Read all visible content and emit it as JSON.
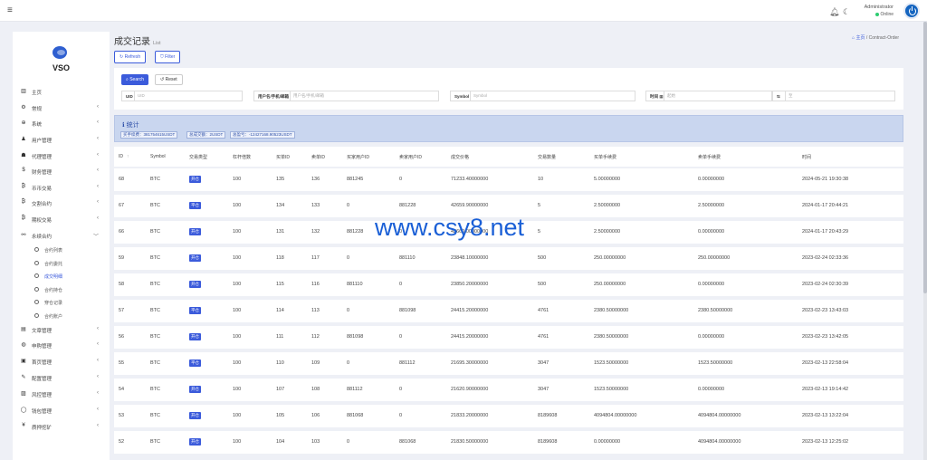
{
  "topbar": {
    "menu_icon": "hamburger-icon",
    "admin_name": "Administrator",
    "status": "Online"
  },
  "sidebar": {
    "logo_text": "VSO",
    "items": [
      {
        "label": "主页",
        "icon": "dashboard-icon",
        "chevron": false
      },
      {
        "label": "常规",
        "icon": "settings-icon",
        "chevron": true
      },
      {
        "label": "系统",
        "icon": "system-icon",
        "chevron": true
      },
      {
        "label": "用户管理",
        "icon": "user-icon",
        "chevron": true
      },
      {
        "label": "代理管理",
        "icon": "agent-icon",
        "chevron": true
      },
      {
        "label": "财务管理",
        "icon": "dollar-icon",
        "chevron": true
      },
      {
        "label": "币币交易",
        "icon": "bitcoin-icon",
        "chevron": true
      },
      {
        "label": "交割合约",
        "icon": "bitcoin-icon",
        "chevron": true
      },
      {
        "label": "期权交易",
        "icon": "bitcoin-icon",
        "chevron": true
      },
      {
        "label": "永续合约",
        "icon": "link-icon",
        "chevron": true
      }
    ],
    "sub_items": [
      "合约列表",
      "合约委托",
      "成交明细",
      "合约持仓",
      "穿仓记录",
      "合约账户"
    ],
    "items_after": [
      {
        "label": "文章管理",
        "icon": "article-icon"
      },
      {
        "label": "申购管理",
        "icon": "globe-icon"
      },
      {
        "label": "首页管理",
        "icon": "home-icon"
      },
      {
        "label": "配置管理",
        "icon": "wrench-icon"
      },
      {
        "label": "风控管理",
        "icon": "image-icon"
      },
      {
        "label": "钱包管理",
        "icon": "circle-icon"
      },
      {
        "label": "质押挖矿",
        "icon": "yen-icon"
      }
    ]
  },
  "page": {
    "title": "成交记录",
    "subtitle": "List",
    "breadcrumb_home": "主页",
    "breadcrumb_current": "Contract-Order",
    "refresh_label": "Refresh",
    "filter_label": "Filter"
  },
  "search": {
    "search_label": "Search",
    "reset_label": "Reset",
    "fields": [
      {
        "label": "UID",
        "placeholder": "UID"
      },
      {
        "label": "用户名/手机/邮箱",
        "placeholder": "用户名/手机/邮箱"
      },
      {
        "label": "Symbol",
        "placeholder": "Symbol"
      },
      {
        "label": "时间",
        "placeholder": "起始",
        "to_placeholder": "至"
      }
    ]
  },
  "stats": {
    "title": "统计",
    "chips": [
      "买手续费：381754615USDT",
      "总成交额：2USDT",
      "总盈亏：-12427168.90523USDT"
    ]
  },
  "table": {
    "headers": [
      "ID",
      "Symbol",
      "交易类型",
      "杠杆倍数",
      "买单ID",
      "卖单ID",
      "买家用户ID",
      "卖家用户ID",
      "成交价格",
      "交易数量",
      "买单手续费",
      "卖单手续费",
      "时间"
    ],
    "rows": [
      [
        "68",
        "BTC",
        "开仓",
        "100",
        "135",
        "136",
        "881245",
        "0",
        "71233.40000000",
        "10",
        "5.00000000",
        "0.00000000",
        "2024-05-21 19:30:38"
      ],
      [
        "67",
        "BTC",
        "平仓",
        "100",
        "134",
        "133",
        "0",
        "881228",
        "42659.90000000",
        "5",
        "2.50000000",
        "2.50000000",
        "2024-01-17 20:44:21"
      ],
      [
        "66",
        "BTC",
        "开仓",
        "100",
        "131",
        "132",
        "881228",
        "0",
        "42660.00000000",
        "5",
        "2.50000000",
        "0.00000000",
        "2024-01-17 20:43:29"
      ],
      [
        "59",
        "BTC",
        "开仓",
        "100",
        "118",
        "117",
        "0",
        "881110",
        "23848.10000000",
        "500",
        "250.00000000",
        "250.00000000",
        "2023-02-24 02:33:36"
      ],
      [
        "58",
        "BTC",
        "开仓",
        "100",
        "115",
        "116",
        "881110",
        "0",
        "23850.20000000",
        "500",
        "250.00000000",
        "0.00000000",
        "2023-02-24 02:30:39"
      ],
      [
        "57",
        "BTC",
        "平仓",
        "100",
        "114",
        "113",
        "0",
        "881098",
        "24415.20000000",
        "4761",
        "2380.50000000",
        "2380.50000000",
        "2023-02-23 13:43:03"
      ],
      [
        "56",
        "BTC",
        "开仓",
        "100",
        "111",
        "112",
        "881098",
        "0",
        "24415.20000000",
        "4761",
        "2380.50000000",
        "0.00000000",
        "2023-02-23 13:42:05"
      ],
      [
        "55",
        "BTC",
        "平仓",
        "100",
        "110",
        "109",
        "0",
        "881112",
        "21695.30000000",
        "3047",
        "1523.50000000",
        "1523.50000000",
        "2023-02-13 22:58:04"
      ],
      [
        "54",
        "BTC",
        "开仓",
        "100",
        "107",
        "108",
        "881112",
        "0",
        "21620.90000000",
        "3047",
        "1523.50000000",
        "0.00000000",
        "2023-02-13 19:14:42"
      ],
      [
        "53",
        "BTC",
        "开仓",
        "100",
        "105",
        "106",
        "881068",
        "0",
        "21833.20000000",
        "8189608",
        "4094804.00000000",
        "4094804.00000000",
        "2023-02-13 13:22:04"
      ],
      [
        "52",
        "BTC",
        "开仓",
        "100",
        "104",
        "103",
        "0",
        "881068",
        "21830.50000000",
        "8189608",
        "0.00000000",
        "4094804.00000000",
        "2023-02-13 12:25:02"
      ]
    ]
  },
  "watermark": "www.csy8.net",
  "colors": {
    "accent": "#3b5bdb",
    "stats_bg": "#c9d6ef",
    "online": "#2ecc71"
  }
}
